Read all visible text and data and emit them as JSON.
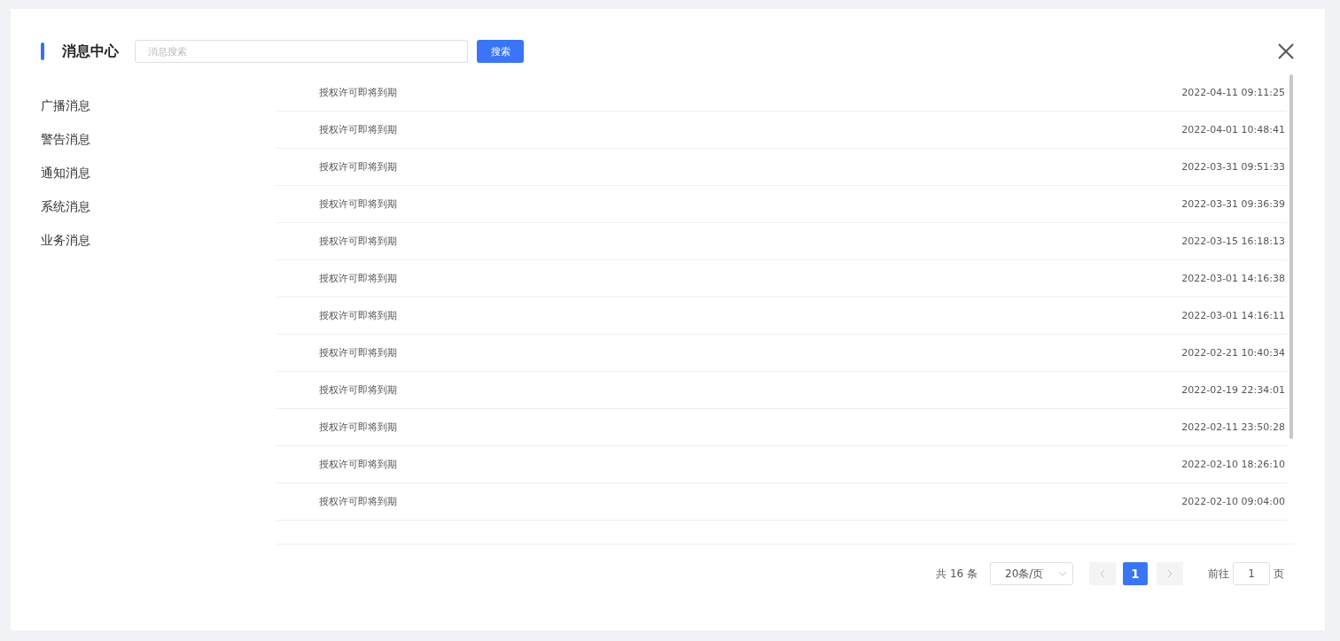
{
  "header": {
    "title": "消息中心",
    "search": {
      "placeholder": "消息搜索"
    },
    "search_button": "搜索"
  },
  "sidebar": {
    "items": [
      "广播消息",
      "警告消息",
      "通知消息",
      "系统消息",
      "业务消息"
    ]
  },
  "messages": [
    {
      "title": "授权许可即将到期",
      "time": "2022-04-11 09:11:25"
    },
    {
      "title": "授权许可即将到期",
      "time": "2022-04-01 10:48:41"
    },
    {
      "title": "授权许可即将到期",
      "time": "2022-03-31 09:51:33"
    },
    {
      "title": "授权许可即将到期",
      "time": "2022-03-31 09:36:39"
    },
    {
      "title": "授权许可即将到期",
      "time": "2022-03-15 16:18:13"
    },
    {
      "title": "授权许可即将到期",
      "time": "2022-03-01 14:16:38"
    },
    {
      "title": "授权许可即将到期",
      "time": "2022-03-01 14:16:11"
    },
    {
      "title": "授权许可即将到期",
      "time": "2022-02-21 10:40:34"
    },
    {
      "title": "授权许可即将到期",
      "time": "2022-02-19 22:34:01"
    },
    {
      "title": "授权许可即将到期",
      "time": "2022-02-11 23:50:28"
    },
    {
      "title": "授权许可即将到期",
      "time": "2022-02-10 18:26:10"
    },
    {
      "title": "授权许可即将到期",
      "time": "2022-02-10 09:04:00"
    }
  ],
  "pagination": {
    "total": "共 16 条",
    "page_size": "20条/页",
    "pages": [
      {
        "label": "1",
        "selected": true
      }
    ],
    "goto_label": "前往",
    "goto_value": "1",
    "goto_suffix": "页"
  }
}
